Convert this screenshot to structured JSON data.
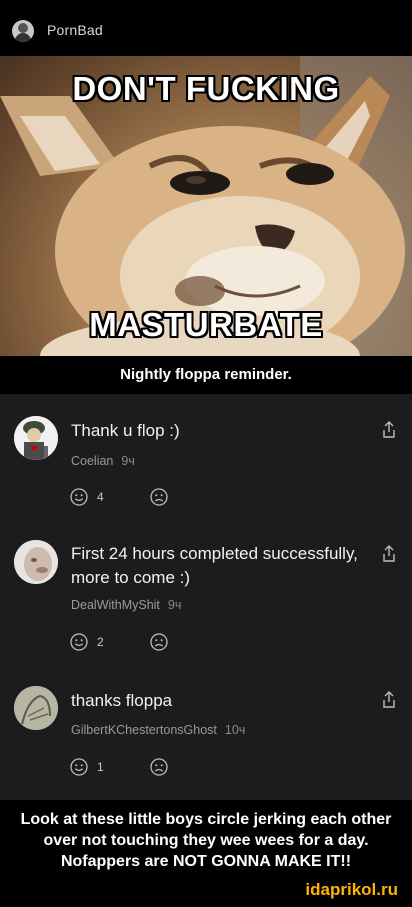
{
  "app": {
    "name": "PornBad",
    "logo_icon": "app-avatar-icon"
  },
  "meme": {
    "top_text": "DON'T FUCKING",
    "bottom_text": "MASTURBATE",
    "caption": "Nightly floppa reminder."
  },
  "comments": [
    {
      "text": "Thank u flop :)",
      "user": "Coelian",
      "time": "9ч",
      "reaction_count": "4",
      "avatar_icon": "soldier-avatar-icon"
    },
    {
      "text": "First 24 hours completed successfully, more to come :)",
      "user": "DealWithMyShit",
      "time": "9ч",
      "reaction_count": "2",
      "avatar_icon": "face-avatar-icon"
    },
    {
      "text": "thanks floppa",
      "user": "GilbertKChestertonsGhost",
      "time": "10ч",
      "reaction_count": "1",
      "avatar_icon": "sketch-avatar-icon"
    }
  ],
  "bottom_caption": "Look at these little boys circle jerking each other over not touching they wee wees for a day. Nofappers are NOT GONNA MAKE IT!!",
  "watermark": "idaprikol.ru",
  "colors": {
    "background": "#000000",
    "comments_bg": "#1c1c1e",
    "watermark": "#ffb300"
  }
}
